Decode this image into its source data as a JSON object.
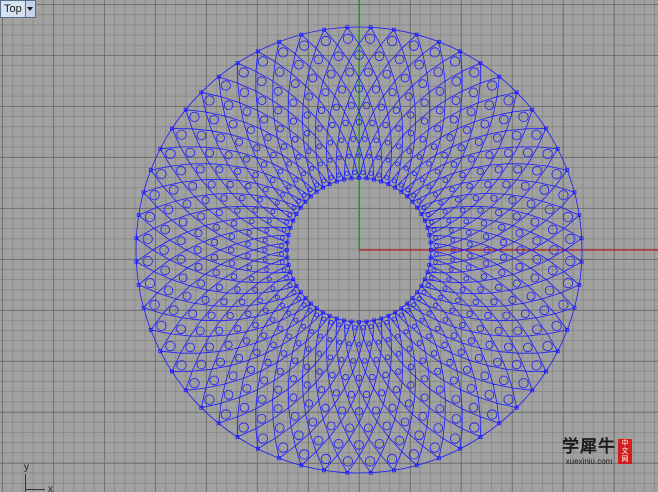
{
  "viewport": {
    "title": "Top",
    "menu_icon": "chevron-down-icon"
  },
  "axis_widget": {
    "y_label": "y",
    "x_label": "x"
  },
  "watermark": {
    "main": "学犀牛",
    "sub": "xuexiniu.com",
    "seal_chars": [
      "中",
      "文",
      "网"
    ]
  },
  "colors": {
    "viewport_bg": "#a1a1a1",
    "geometry": "#1a1aff",
    "x_axis": "#c00000",
    "y_axis": "#00a000",
    "watermark_seal": "#d11f1f"
  }
}
